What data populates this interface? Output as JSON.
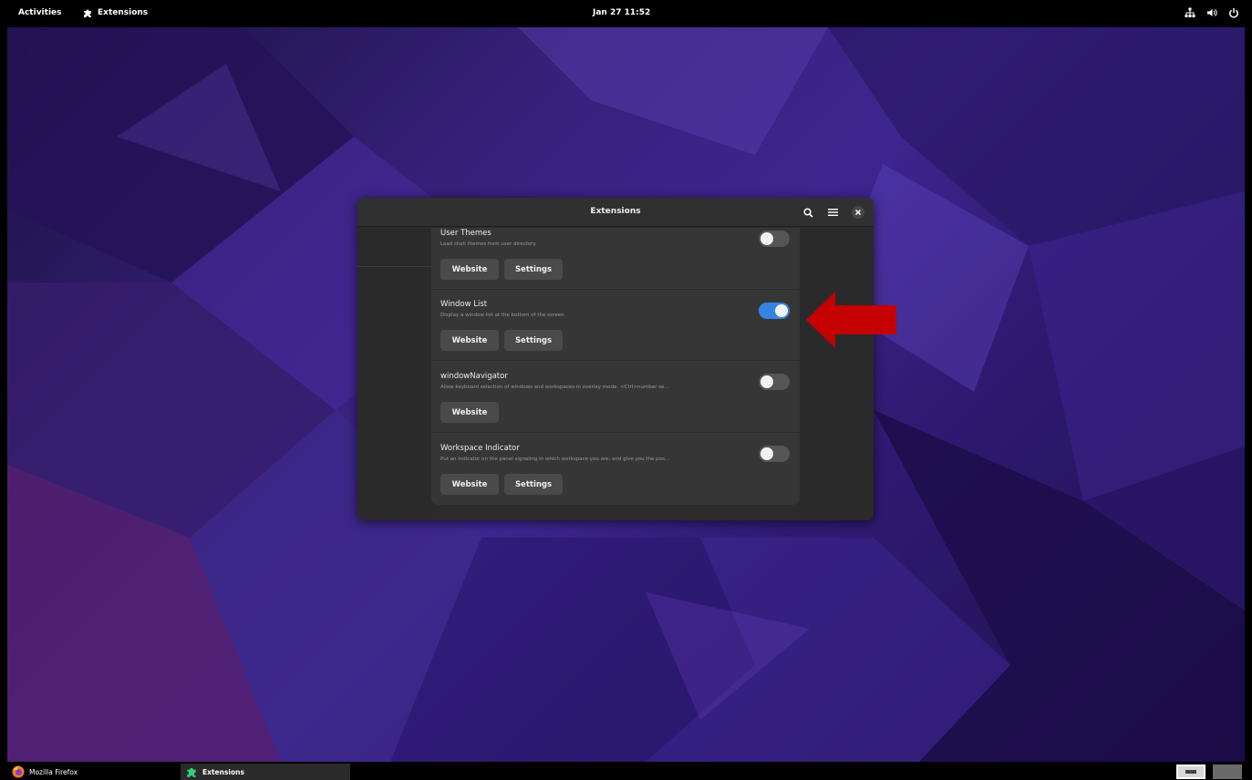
{
  "topbar": {
    "activities": "Activities",
    "app_menu": "Extensions",
    "clock": "Jan 27  11:52",
    "tray_icons": [
      "network-icon",
      "volume-icon",
      "power-icon"
    ]
  },
  "dialog": {
    "title": "Extensions",
    "header_icons": [
      "search-icon",
      "menu-icon",
      "close-icon"
    ],
    "accent_color": "#3584e4",
    "extensions": [
      {
        "name": "User Themes",
        "description": "Load shell themes from user directory.",
        "enabled": false,
        "buttons": [
          "Website",
          "Settings"
        ]
      },
      {
        "name": "Window List",
        "description": "Display a window list at the bottom of the screen.",
        "enabled": true,
        "buttons": [
          "Website",
          "Settings"
        ]
      },
      {
        "name": "windowNavigator",
        "description": "Allow keyboard selection of windows and workspaces in overlay mode. <Ctrl>number se...",
        "enabled": false,
        "buttons": [
          "Website"
        ]
      },
      {
        "name": "Workspace Indicator",
        "description": "Put an indicator on the panel signaling in which workspace you are, and give you the pos...",
        "enabled": false,
        "buttons": [
          "Website",
          "Settings"
        ]
      }
    ]
  },
  "annotation": {
    "arrow_color": "#c40000"
  },
  "taskbar": {
    "items": [
      {
        "label": "Mozilla Firefox",
        "icon": "firefox-icon",
        "active": false
      },
      {
        "label": "Extensions",
        "icon": "puzzle-icon",
        "active": true
      }
    ],
    "workspaces": 2,
    "current_workspace": 1
  }
}
